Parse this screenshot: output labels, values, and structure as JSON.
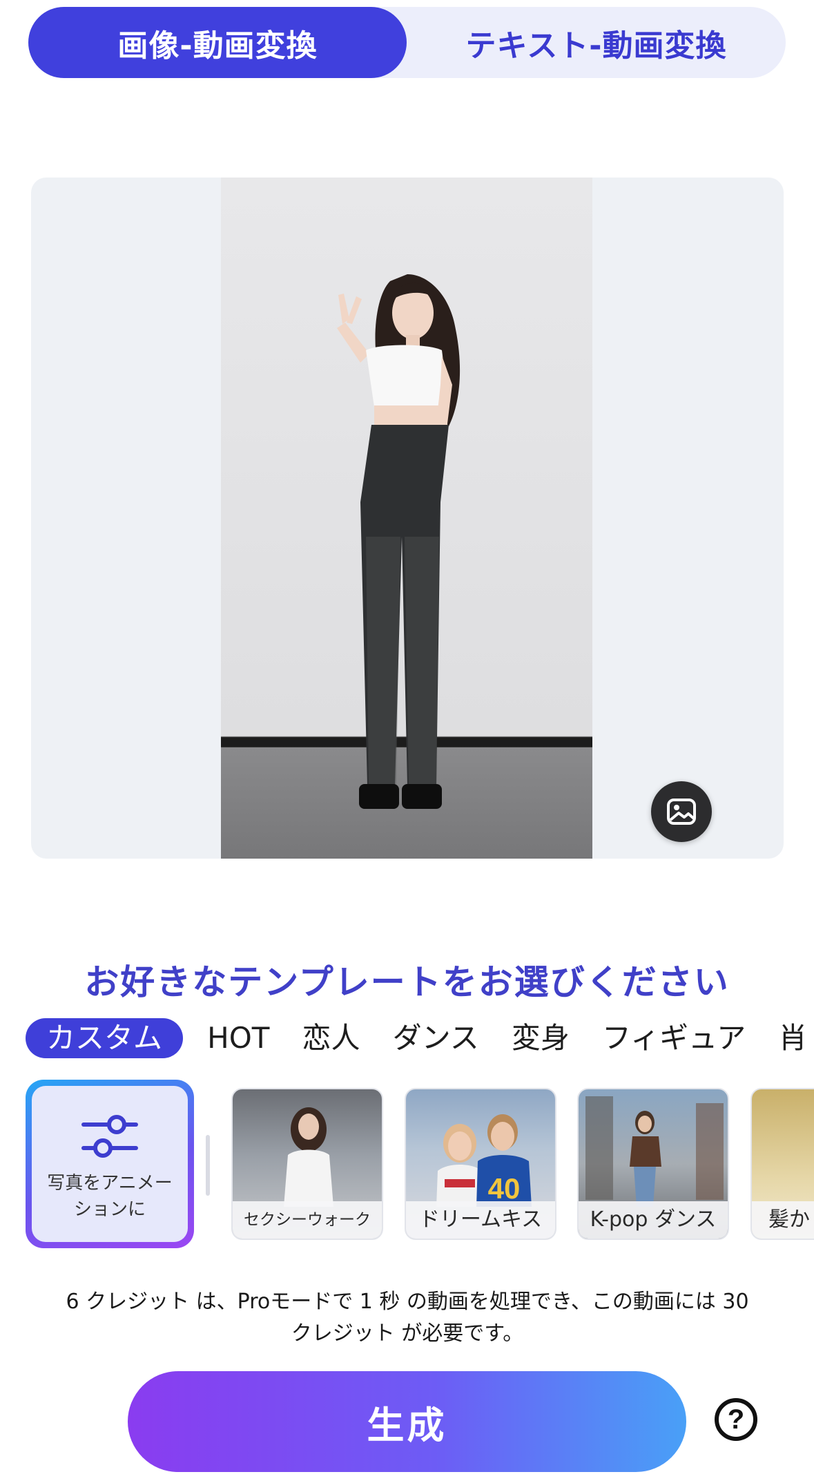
{
  "mode_switch": {
    "tabs": [
      {
        "label": "画像-動画変換",
        "active": true
      },
      {
        "label": "テキスト-動画変換",
        "active": false
      }
    ]
  },
  "preview": {
    "replace_icon": "image-icon"
  },
  "templates": {
    "title": "お好きなテンプレートをお選びください",
    "categories": [
      "カスタム",
      "HOT",
      "恋人",
      "ダンス",
      "変身",
      "フィギュア",
      "肖"
    ],
    "active_category": "カスタム",
    "custom": {
      "label": "写真をアニメーションに",
      "icon": "sliders-icon"
    },
    "items": [
      {
        "label": "セクシーウォーク"
      },
      {
        "label": "ドリームキス"
      },
      {
        "label": "K-pop ダンス"
      },
      {
        "label": "髪か"
      }
    ]
  },
  "credit_note": "6 クレジット は、Proモードで 1 秒 の動画を処理でき、この動画には 30 クレジット が必要です。",
  "generate_label": "生成",
  "help_label": "?",
  "colors": {
    "accent": "#4040dd",
    "title": "#4040c8",
    "gradient_start": "#8a3cf0",
    "gradient_end": "#49a0f7"
  }
}
